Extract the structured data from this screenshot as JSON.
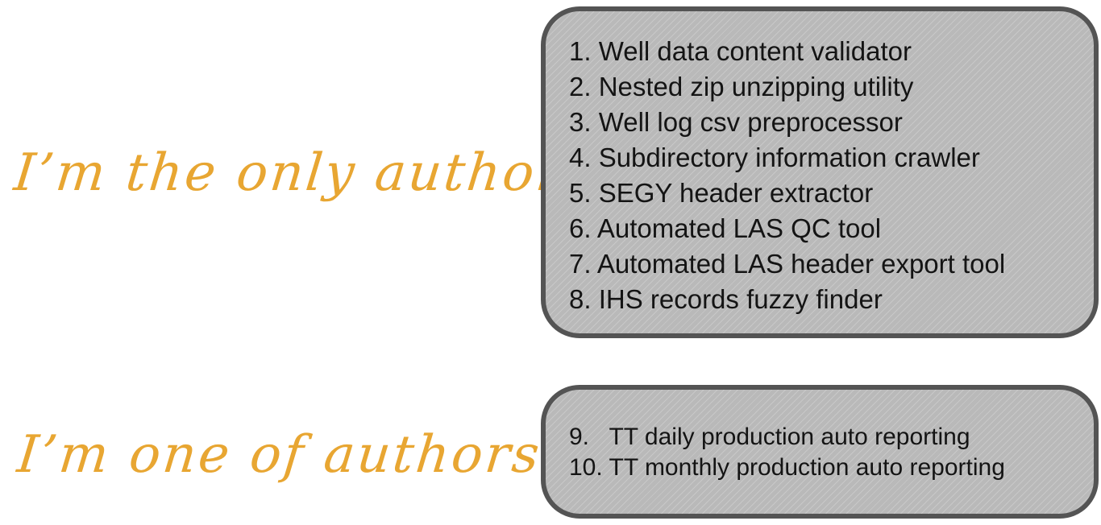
{
  "labels": {
    "only_author": "I’m the only author",
    "one_of_authors": "I’m one of authors"
  },
  "solo_projects": [
    "1. Well data content validator",
    "2. Nested zip unzipping utility",
    "3. Well log csv preprocessor",
    "4. Subdirectory information crawler",
    "5. SEGY header extractor",
    "6. Automated LAS QC tool",
    "7. Automated LAS header export tool",
    "8. IHS records fuzzy finder"
  ],
  "coauthor_projects": [
    "9.   TT daily production auto reporting",
    "10. TT monthly production auto reporting"
  ],
  "colors": {
    "label_text": "#e8a632",
    "box_fill": "#b9b9b9",
    "box_border": "#545454",
    "list_text": "#141414"
  }
}
